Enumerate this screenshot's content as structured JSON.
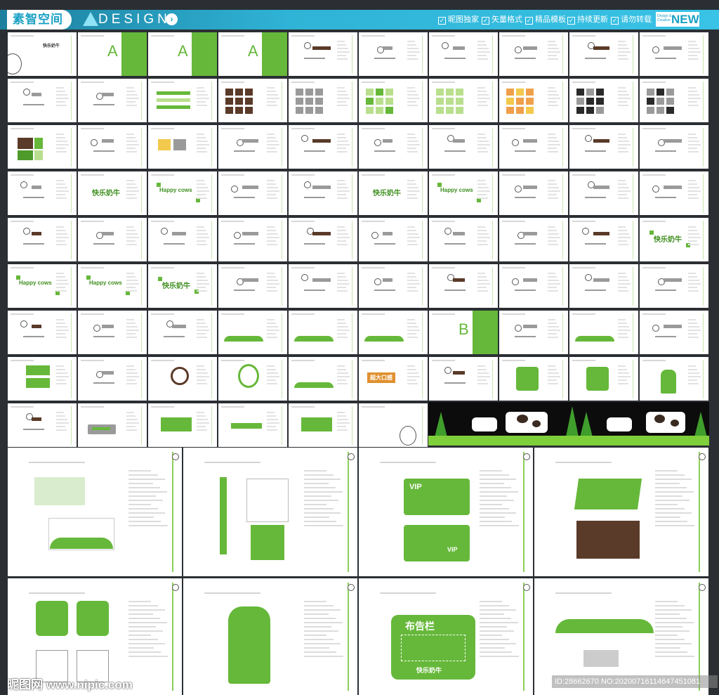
{
  "header": {
    "brand": "素智空间",
    "design_label": "DESIGN.",
    "arrow": "›",
    "features": [
      "昵图独家",
      "矢量格式",
      "精品模板",
      "持续更新",
      "请勿转载"
    ],
    "new_small": "Design & Creative",
    "new_label": "NEW"
  },
  "thumbs": {
    "section_a": "A",
    "section_b": "B",
    "logo_cn": "快乐奶牛",
    "logo_en": "Happy cows",
    "label_big": "超大口感"
  },
  "large_pages": {
    "vip": "VIP",
    "bulletin": "布告栏",
    "logo_cn": "快乐奶牛"
  },
  "footer": {
    "watermark_left": "昵图网 www.nipic.com",
    "watermark_right": "ID:28662670 NO:20200716114647451081"
  },
  "colors": {
    "accent_green": "#66b83a",
    "brown": "#5a3a28",
    "banner_blue": "#2fb3d6"
  }
}
